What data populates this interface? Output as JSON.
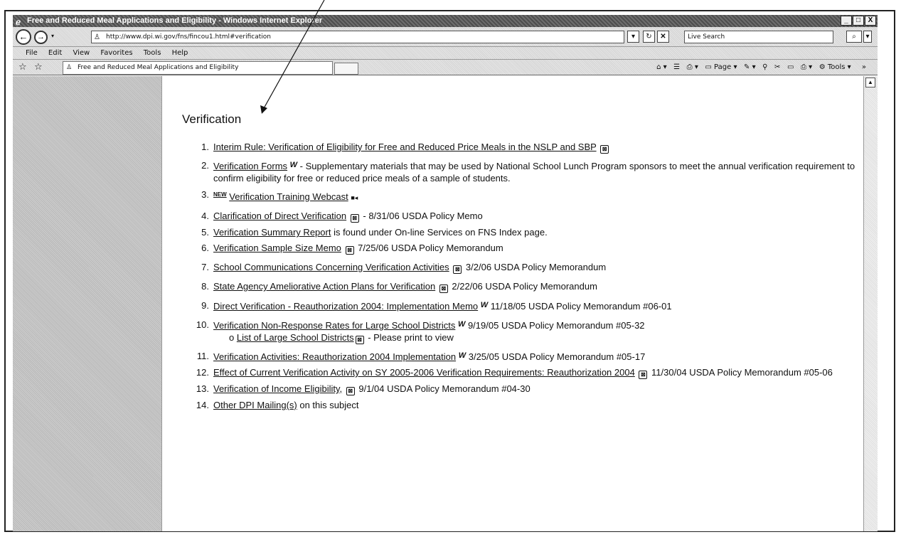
{
  "window": {
    "title": "Free and Reduced Meal Applications and Eligibility - Windows Internet Explorer",
    "buttons": [
      "_",
      "□",
      "X"
    ]
  },
  "nav": {
    "address": "http://www.dpi.wi.gov/fns/fincou1.html#verification",
    "search_placeholder": "Live Search"
  },
  "menu": [
    "File",
    "Edit",
    "View",
    "Favorites",
    "Tools",
    "Help"
  ],
  "tab": {
    "label": "Free and Reduced Meal Applications and Eligibility"
  },
  "commands": {
    "page": "Page",
    "tools": "Tools"
  },
  "page": {
    "title": "Verification"
  },
  "items": [
    {
      "num": "1.",
      "link": "Interim Rule: Verification of Eligibility for Free and Reduced Price Meals in the NSLP and SBP",
      "icon": "pdf",
      "rest": ""
    },
    {
      "num": "2.",
      "link": "Verification Forms",
      "icon": "word",
      "rest": " - Supplementary materials that may be used by National School Lunch Program sponsors to meet the annual verification requirement to confirm eligibility for free or reduced price meals of a sample of students."
    },
    {
      "num": "3.",
      "link": "Verification Training Webcast",
      "icon": "video",
      "rest": "",
      "badge": "NEW"
    },
    {
      "num": "4.",
      "link": "Clarification of Direct Verification",
      "icon": "pdf",
      "rest": " - 8/31/06 USDA Policy Memo"
    },
    {
      "num": "5.",
      "link": "Verification Summary Report",
      "icon": "",
      "rest": " is found under On-line Services on FNS Index page."
    },
    {
      "num": "6.",
      "link": "Verification Sample Size Memo",
      "icon": "pdf",
      "rest": " 7/25/06 USDA Policy Memorandum"
    },
    {
      "num": "7.",
      "link": "School Communications Concerning Verification Activities",
      "icon": "pdf",
      "rest": " 3/2/06 USDA Policy Memorandum"
    },
    {
      "num": "8.",
      "link": "State Agency Ameliorative Action Plans for Verification",
      "icon": "pdf",
      "rest": " 2/22/06 USDA Policy Memorandum"
    },
    {
      "num": "9.",
      "link": "Direct Verification - Reauthorization 2004: Implementation Memo",
      "icon": "word",
      "rest": " 11/18/05 USDA Policy Memorandum #06-01"
    },
    {
      "num": "10.",
      "link": "Verification Non-Response Rates for Large School Districts",
      "icon": "word",
      "rest": " 9/19/05 USDA Policy Memorandum #05-32",
      "sub": {
        "link": "List of Large School Districts",
        "icon": "pdf",
        "rest": " - Please print to view"
      }
    },
    {
      "num": "11.",
      "link": "Verification Activities: Reauthorization 2004 Implementation",
      "icon": "word",
      "rest": " 3/25/05 USDA Policy Memorandum #05-17"
    },
    {
      "num": "12.",
      "link": "Effect of Current Verification Activity on SY 2005-2006 Verification Requirements: Reauthorization 2004",
      "icon": "pdf",
      "rest": " 11/30/04 USDA Policy Memorandum #05-06"
    },
    {
      "num": "13.",
      "link": "Verification of Income Eligibility,",
      "icon": "pdf",
      "rest": " 9/1/04 USDA Policy Memorandum #04-30"
    },
    {
      "num": "14.",
      "link": "Other DPI Mailing(s)",
      "icon": "",
      "rest": " on this subject"
    }
  ]
}
